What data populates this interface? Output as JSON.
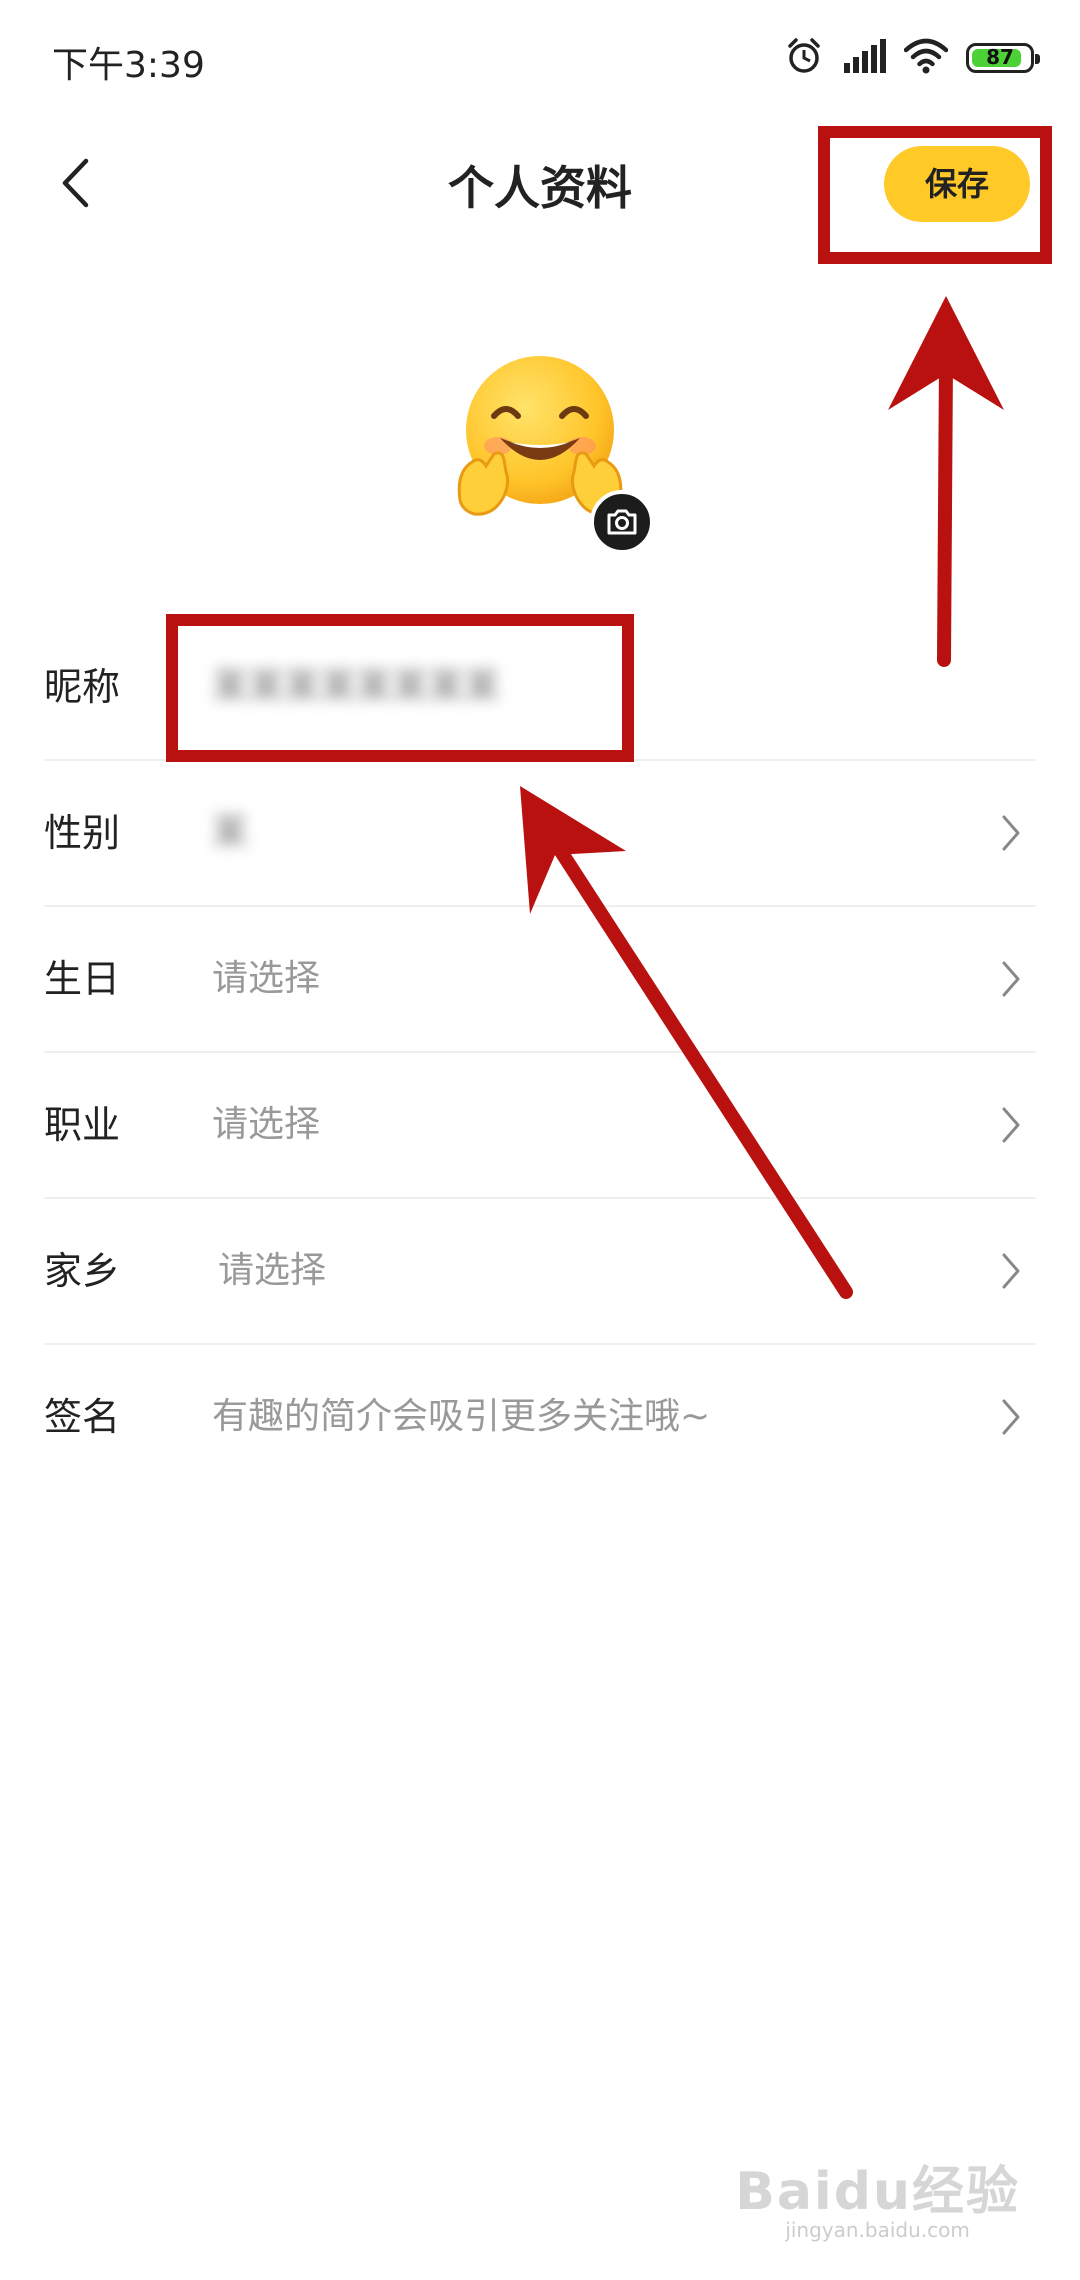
{
  "status_bar": {
    "time": "下午3:39",
    "battery_percent": 87,
    "battery_label": "87",
    "icons": [
      "alarm-icon",
      "signal-icon",
      "wifi-icon",
      "battery-icon"
    ]
  },
  "header": {
    "title": "个人资料",
    "back_icon": "chevron-left-icon",
    "save_label": "保存"
  },
  "avatar": {
    "emoji": "🤗",
    "badge_icon": "camera-icon"
  },
  "form": {
    "rows": [
      {
        "label": "昵称",
        "value": "某某某某某某某某",
        "blurred": true,
        "chevron": false
      },
      {
        "label": "性别",
        "value": "某",
        "blurred": true,
        "chevron": true
      },
      {
        "label": "生日",
        "value": "请选择",
        "blurred": false,
        "chevron": true
      },
      {
        "label": "职业",
        "value": "请选择",
        "blurred": false,
        "chevron": true
      },
      {
        "label": "家乡",
        "value": "请选择",
        "blurred": false,
        "chevron": true
      },
      {
        "label": "签名",
        "value": "有趣的简介会吸引更多关注哦~",
        "blurred": false,
        "chevron": true
      }
    ]
  },
  "colors": {
    "accent": "#ffc928",
    "annotation_red": "#b8110f",
    "placeholder": "#999999",
    "divider": "#efefef"
  },
  "watermark": {
    "main": "Baidu经验",
    "sub": "jingyan.baidu.com"
  }
}
